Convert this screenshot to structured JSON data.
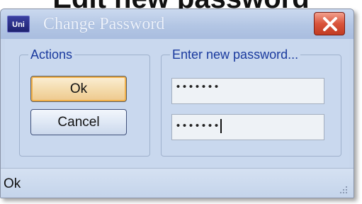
{
  "background": {
    "caption": "Edit new password"
  },
  "window": {
    "app_icon_text": "Uni",
    "title": "Change Password",
    "close_icon": "close-x-icon"
  },
  "actions_group": {
    "legend": "Actions",
    "ok_label": "Ok",
    "cancel_label": "Cancel"
  },
  "password_group": {
    "legend": "Enter new password...",
    "password_value": "•••••••",
    "confirm_value": "•••••••"
  },
  "statusbar": {
    "text": "Ok",
    "grip_icon": "resize-grip-icon"
  },
  "colors": {
    "close_button": "#d9543b",
    "focused_button_border": "#f0b04a",
    "legend_text": "#1a3a9e",
    "window_background": "#c9d8ee"
  }
}
